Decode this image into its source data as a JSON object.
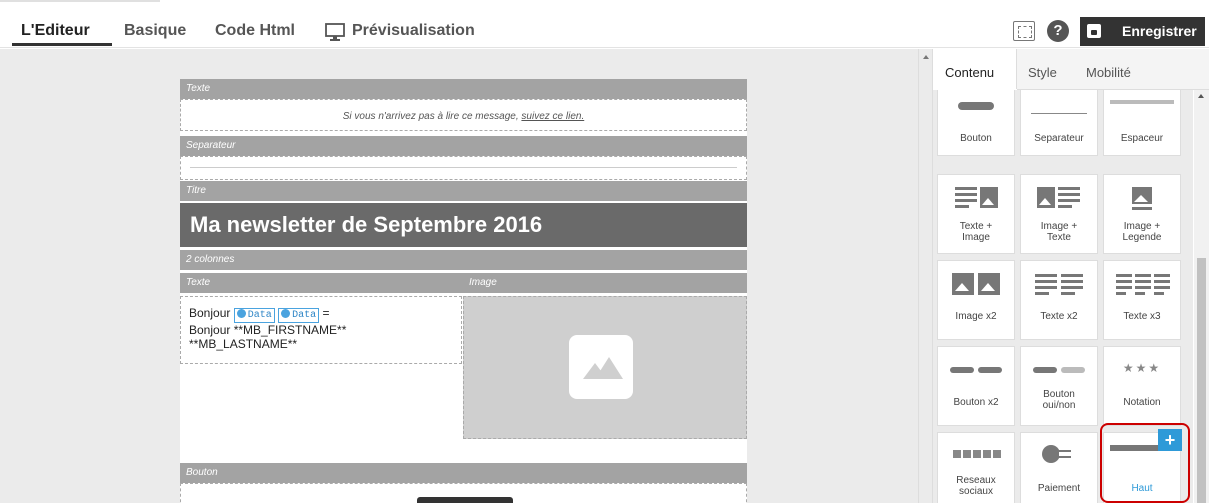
{
  "header": {
    "tabs": [
      {
        "label": "L'Editeur"
      },
      {
        "label": "Basique"
      },
      {
        "label": "Code Html"
      },
      {
        "label": "Prévisualisation"
      }
    ],
    "save_label": "Enregistrer",
    "help_label": "?"
  },
  "editor": {
    "blocks": {
      "texte_top": "Texte",
      "separateur": "Separateur",
      "titre": "Titre",
      "deux_colonnes": "2 colonnes",
      "col_texte": "Texte",
      "col_image": "Image",
      "bouton": "Bouton"
    },
    "info_text": "Si vous n'arrivez pas à lire ce message, ",
    "info_link": "suivez ce lien.",
    "title": "Ma newsletter de Septembre 2016",
    "greeting_prefix": "Bonjour",
    "data_chip": "Data",
    "greeting_eq": "=",
    "greeting_line2": "Bonjour **MB_FIRSTNAME**",
    "greeting_line3": "**MB_LASTNAME**"
  },
  "panel": {
    "tabs": [
      {
        "label": "Contenu"
      },
      {
        "label": "Style"
      },
      {
        "label": "Mobilité"
      }
    ],
    "tiles": {
      "bouton": "Bouton",
      "separateur": "Separateur",
      "espaceur": "Espaceur",
      "texte_image_1": "Texte +",
      "texte_image_2": "Image",
      "image_texte_1": "Image +",
      "image_texte_2": "Texte",
      "image_legende_1": "Image +",
      "image_legende_2": "Legende",
      "image_x2": "Image x2",
      "texte_x2": "Texte x2",
      "texte_x3": "Texte x3",
      "bouton_x2": "Bouton x2",
      "bouton_oui_1": "Bouton",
      "bouton_oui_2": "oui/non",
      "notation": "Notation",
      "reseaux_1": "Reseaux",
      "reseaux_2": "sociaux",
      "paiement": "Paiement",
      "haut": "Haut"
    },
    "add_label": "+"
  },
  "colors": {
    "accent": "#2e9ad8",
    "highlight": "#cc0000",
    "dark": "#333333"
  }
}
